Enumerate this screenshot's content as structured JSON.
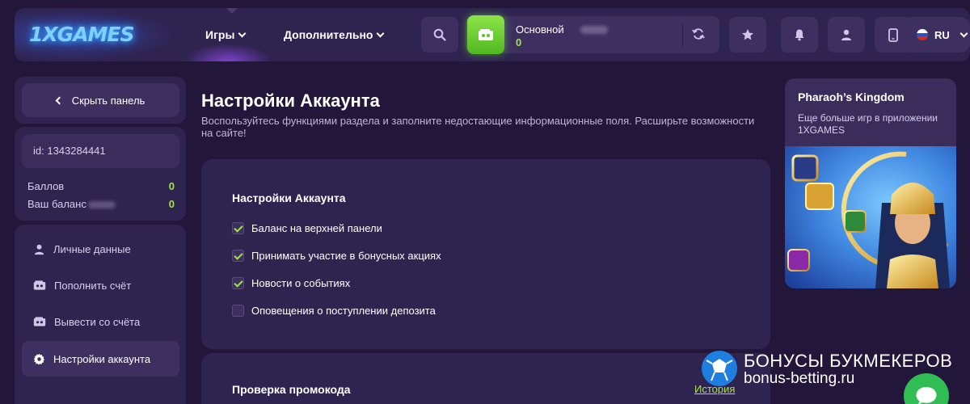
{
  "header": {
    "logo_text": "1XGAMES",
    "nav": [
      {
        "label": "Игры"
      },
      {
        "label": "Дополнительно"
      }
    ],
    "balance": {
      "label": "Основной",
      "value": "0"
    },
    "language": "RU",
    "icons": [
      "search-icon",
      "wallet-icon",
      "refresh-icon",
      "star-icon",
      "bell-icon",
      "user-icon",
      "phone-icon",
      "flag-ru-icon",
      "chevron-down-icon"
    ]
  },
  "sidebar": {
    "hide_label": "Скрыть панель",
    "account_id": "id: 1343284441",
    "stats": [
      {
        "label": "Баллов",
        "value": "0"
      },
      {
        "label": "Ваш баланс",
        "value": "0"
      }
    ],
    "menu": [
      {
        "label": "Личные данные",
        "icon": "user-icon"
      },
      {
        "label": "Пополнить счёт",
        "icon": "wallet-icon"
      },
      {
        "label": "Вывести со счёта",
        "icon": "wallet-icon"
      },
      {
        "label": "Настройки аккаунта",
        "icon": "gear-icon"
      }
    ]
  },
  "main": {
    "title": "Настройки Аккаунта",
    "subtitle": "Воспользуйтесь функциями раздела и заполните недостающие информационные поля. Расширьте возможности на сайте!",
    "settings": {
      "title": "Настройки Аккаунта",
      "options": [
        {
          "label": "Баланс на верхней панели",
          "checked": true
        },
        {
          "label": "Принимать участие в бонусных акциях",
          "checked": true
        },
        {
          "label": "Новости о событиях",
          "checked": true
        },
        {
          "label": "Оповещения о поступлении депозита",
          "checked": false
        }
      ]
    },
    "promo": {
      "title": "Проверка промокода",
      "history_link": "История"
    }
  },
  "banner": {
    "title": "Pharaoh’s Kingdom",
    "subtitle": "Еще больше игр в приложении 1XGAMES"
  },
  "watermark": {
    "line1": "БОНУСЫ БУКМЕКЕРОВ",
    "line2": "bonus-betting.ru"
  },
  "colors": {
    "background": "#22163a",
    "panel": "#2f2350",
    "button": "#3d3060",
    "accent_green": "#a4e34f",
    "chat_green": "#2fbd54"
  }
}
